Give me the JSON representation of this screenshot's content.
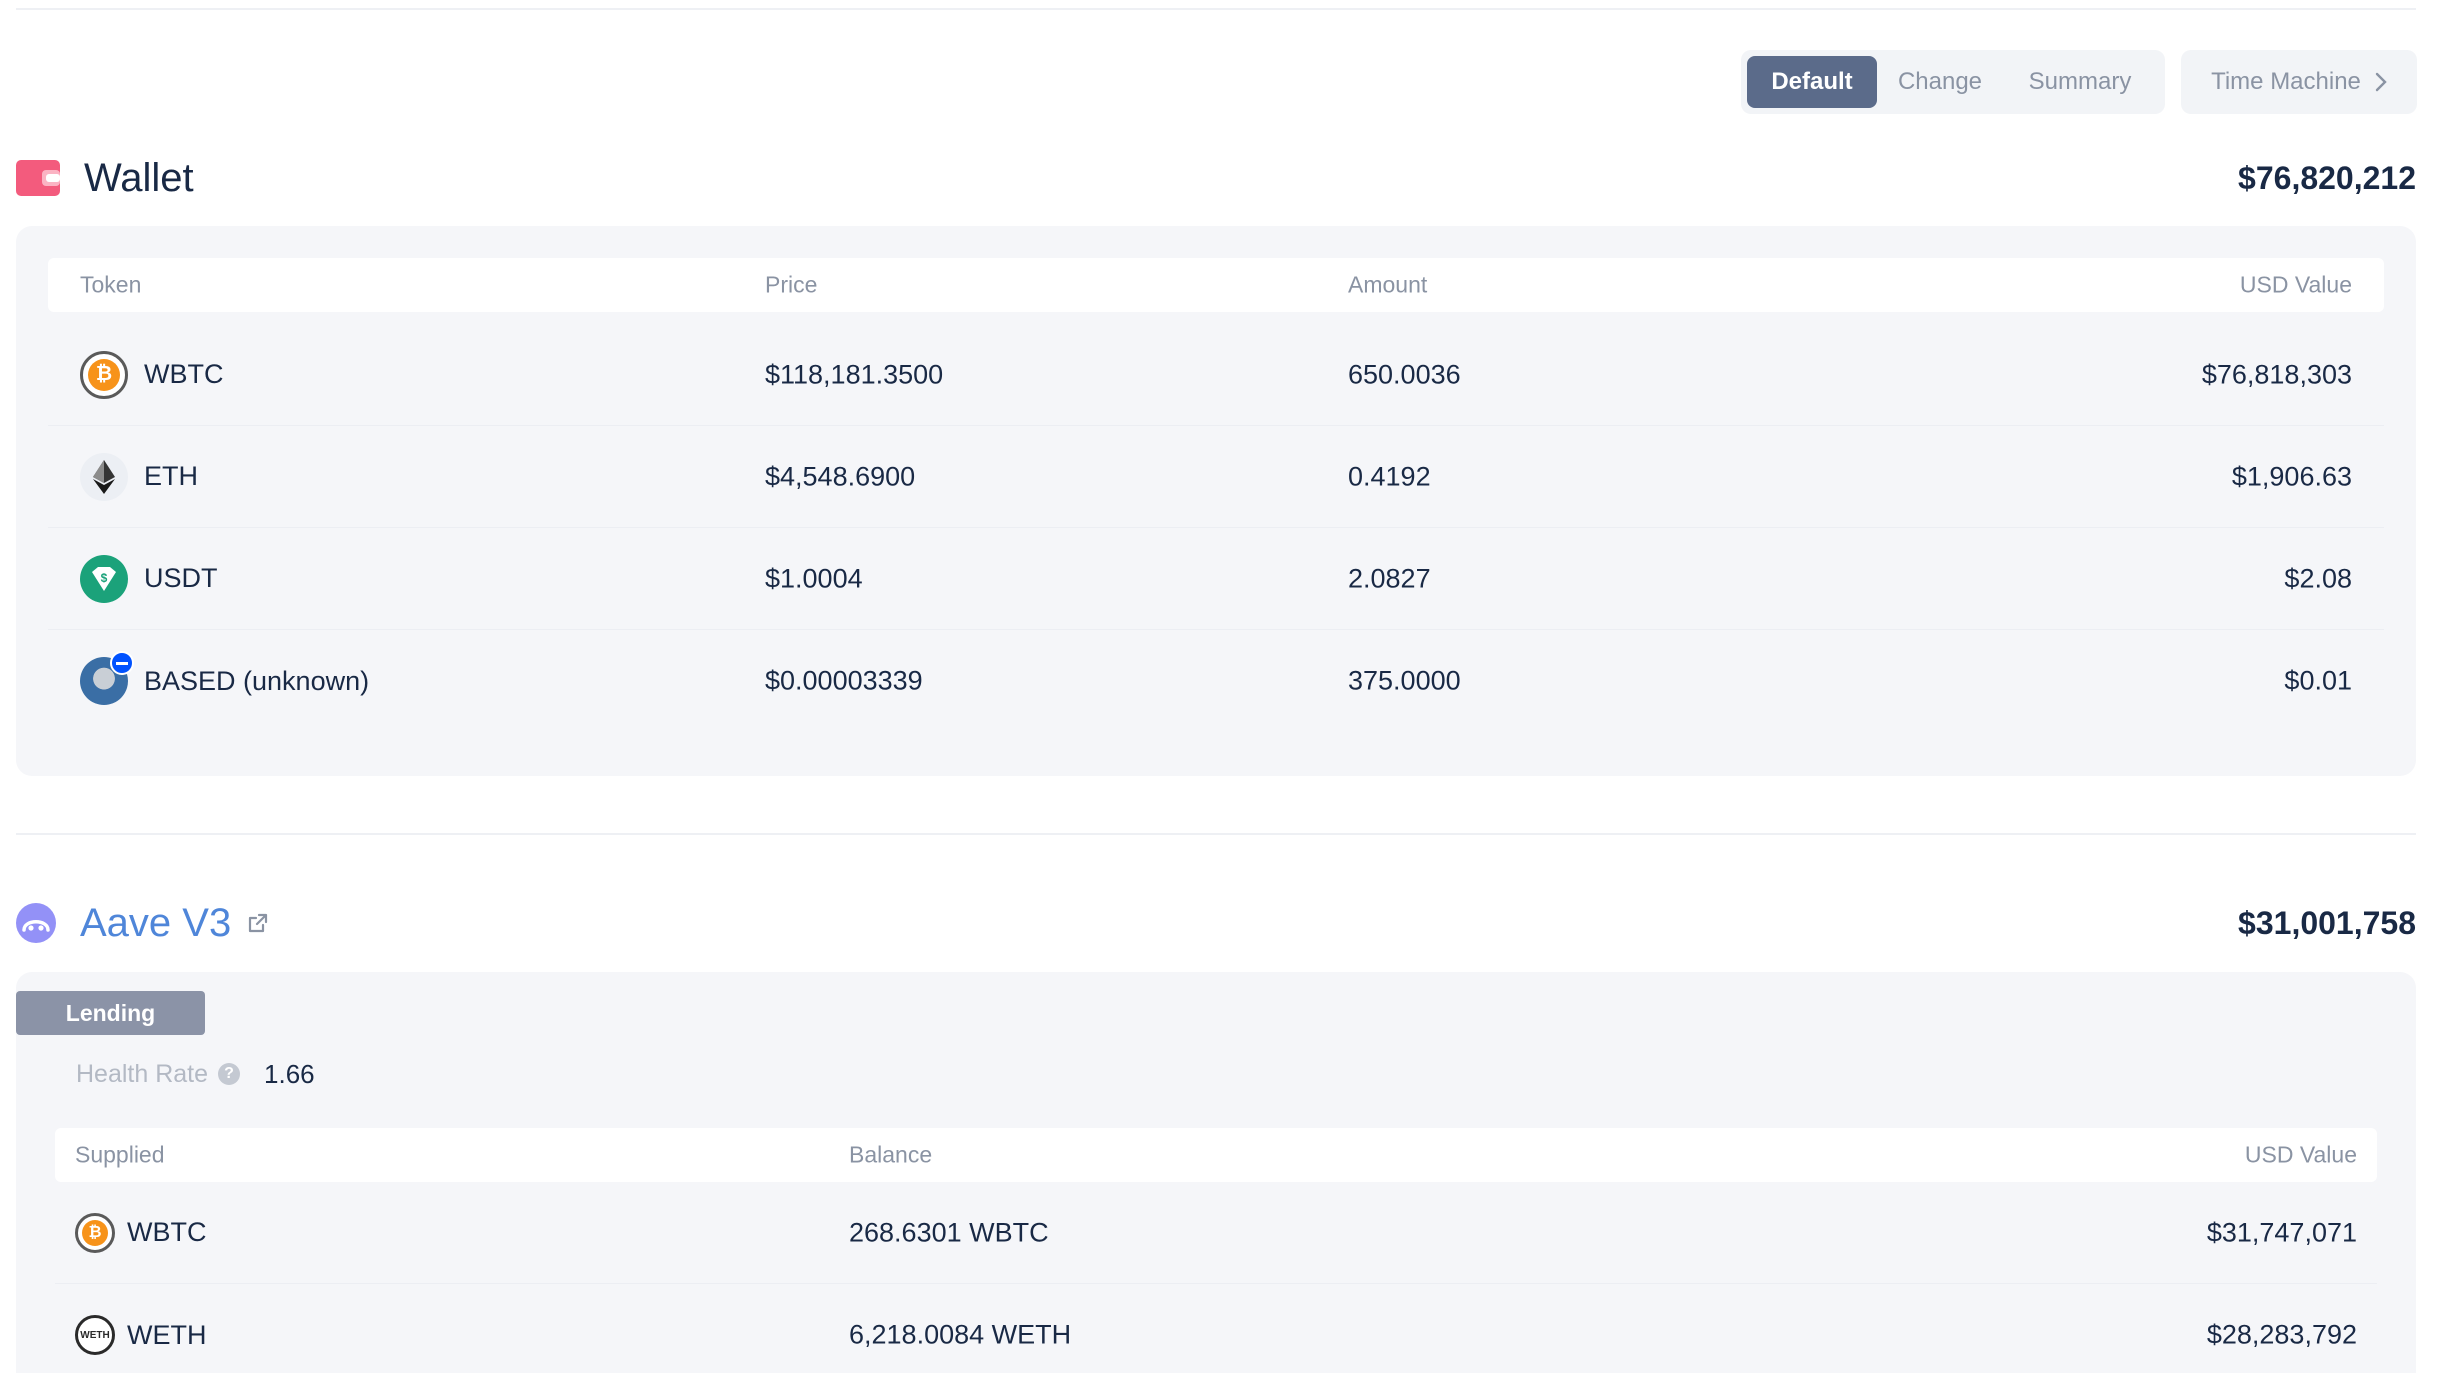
{
  "view_switch": {
    "tabs": [
      "Default",
      "Change",
      "Summary"
    ],
    "active": "Default",
    "time_machine_label": "Time Machine"
  },
  "wallet": {
    "title": "Wallet",
    "total": "$76,820,212",
    "icon_color": "#f35b7d",
    "columns": [
      "Token",
      "Price",
      "Amount",
      "USD Value"
    ],
    "rows": [
      {
        "token": "WBTC",
        "price": "$118,181.3500",
        "amount": "650.0036",
        "usd_value": "$76,818,303",
        "icon": "wbtc-icon"
      },
      {
        "token": "ETH",
        "price": "$4,548.6900",
        "amount": "0.4192",
        "usd_value": "$1,906.63",
        "icon": "eth-icon"
      },
      {
        "token": "USDT",
        "price": "$1.0004",
        "amount": "2.0827",
        "usd_value": "$2.08",
        "icon": "usdt-icon"
      },
      {
        "token": "BASED (unknown)",
        "price": "$0.00003339",
        "amount": "375.0000",
        "usd_value": "$0.01",
        "icon": "based-icon"
      }
    ]
  },
  "aave": {
    "title": "Aave V3",
    "total": "$31,001,758",
    "icon_color": "#9391f7",
    "tag": "Lending",
    "health_label": "Health Rate",
    "health_value": "1.66",
    "columns": [
      "Supplied",
      "Balance",
      "USD Value"
    ],
    "rows": [
      {
        "token": "WBTC",
        "balance": "268.6301 WBTC",
        "usd_value": "$31,747,071",
        "icon": "wbtc-icon"
      },
      {
        "token": "WETH",
        "balance": "6,218.0084 WETH",
        "usd_value": "$28,283,792",
        "icon": "weth-icon"
      }
    ]
  },
  "colors": {
    "accent_active_tab": "#5b6b8a",
    "aave_title": "#4f86d9",
    "panel_bg": "#f5f6f9"
  }
}
